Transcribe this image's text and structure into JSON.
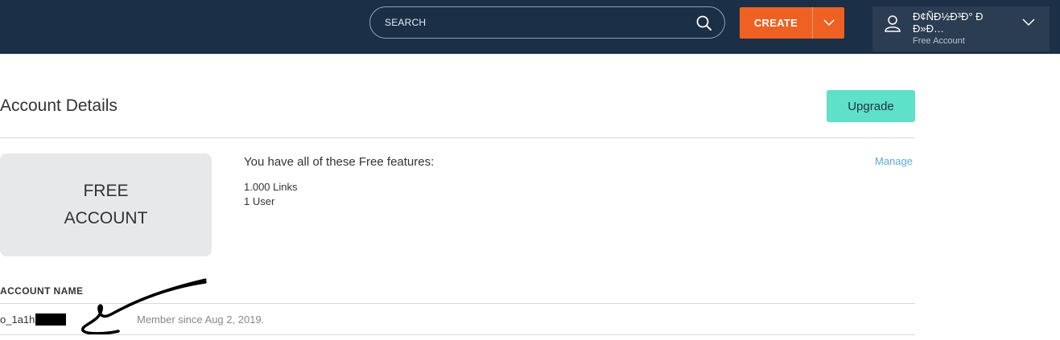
{
  "header": {
    "search": {
      "placeholder": "SEARCH"
    },
    "create": {
      "label": "CREATE"
    },
    "account": {
      "name": "Ð¢ÑÐ½Ð³Ð° ÐÐ»Ð…",
      "type": "Free Account"
    }
  },
  "page": {
    "title": "Account Details",
    "upgrade_label": "Upgrade",
    "plan": {
      "line1": "FREE",
      "line2": "ACCOUNT"
    },
    "features": {
      "title": "You have all of these Free features:",
      "items": [
        "1.000 Links",
        "1 User"
      ],
      "manage_label": "Manage"
    },
    "account_section": {
      "label": "ACCOUNT NAME",
      "account_id": "o_1a1h",
      "member_since": "Member since Aug 2, 2019."
    }
  },
  "colors": {
    "topbar": "#1b2f46",
    "create_button": "#ee6123",
    "upgrade_button": "#5fe0c8",
    "link": "#5fa9d7"
  }
}
